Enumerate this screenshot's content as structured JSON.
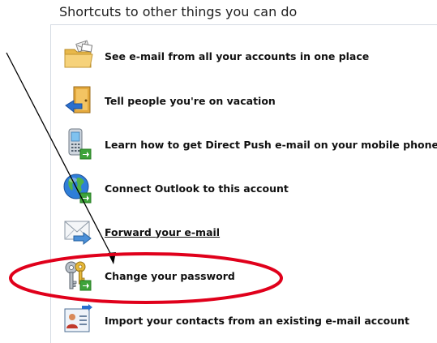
{
  "shortcuts": {
    "title": "Shortcuts to other things you can do",
    "items": [
      {
        "label": "See e-mail from all your accounts in one place",
        "icon": "folder-with-mail-icon"
      },
      {
        "label": "Tell people you're on vacation",
        "icon": "door-arrow-icon"
      },
      {
        "label": "Learn how to get Direct Push e-mail on your mobile phone",
        "icon": "mobile-phone-icon"
      },
      {
        "label": "Connect Outlook to this account",
        "icon": "globe-icon"
      },
      {
        "label": "Forward your e-mail",
        "icon": "envelope-forward-icon"
      },
      {
        "label": "Change your password",
        "icon": "keys-icon"
      },
      {
        "label": "Import your contacts from an existing e-mail account",
        "icon": "contact-card-import-icon"
      }
    ]
  },
  "annotation": {
    "ellipse_color": "#e0001b",
    "arrow_color": "#000000"
  }
}
